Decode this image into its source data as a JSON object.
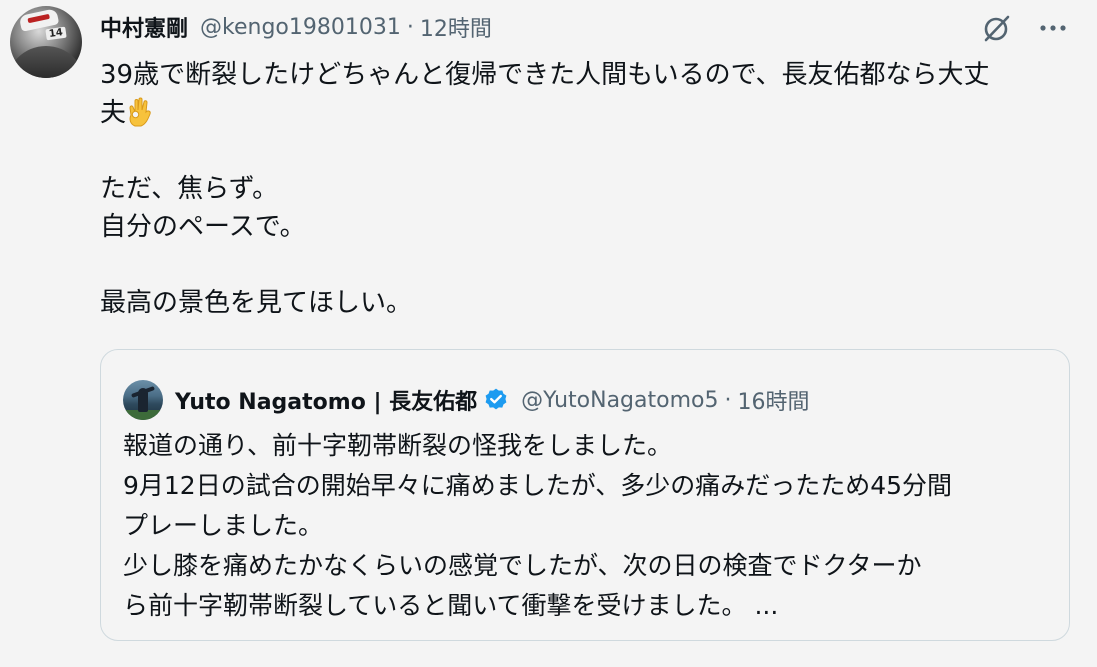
{
  "tweet": {
    "author": {
      "display_name": "中村憲剛",
      "handle": "@kengo19801031",
      "avatar_icon": "profile-photo"
    },
    "separator": "·",
    "time": "12時間",
    "actions": {
      "grok_icon": "grok-icon",
      "more_icon": "more-icon"
    },
    "text_lines": [
      "39歳で断裂したけどちゃんと復帰できた人間もいるので、長友佑都なら大丈",
      "夫",
      "",
      "ただ、焦らず。",
      "自分のペースで。",
      "",
      "最高の景色を見てほしい。"
    ],
    "emoji": "ok-hand-emoji"
  },
  "quote": {
    "author": {
      "display_name": "Yuto Nagatomo | 長友佑都",
      "handle": "@YutoNagatomo5",
      "verified_icon": "verified-badge-icon"
    },
    "separator": "·",
    "time": "16時間",
    "text_lines": [
      "報道の通り、前十字靭帯断裂の怪我をしました。",
      "9月12日の試合の開始早々に痛めましたが、多少の痛みだったため45分間",
      "プレーしました。",
      "少し膝を痛めたかなくらいの感覚でしたが、次の日の検査でドクターか",
      "ら前十字靭帯断裂していると聞いて衝撃を受けました。 ..."
    ]
  },
  "colors": {
    "background": "#f4f4f4",
    "text": "#0f1419",
    "secondary_text": "#536471",
    "border": "#cfd9de",
    "verified_blue": "#1d9bf0"
  }
}
